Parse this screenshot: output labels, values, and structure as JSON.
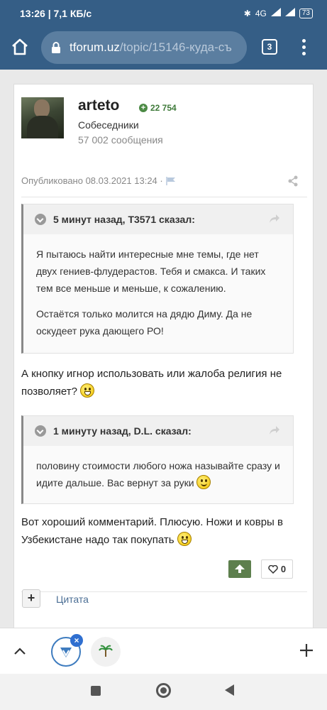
{
  "status_bar": {
    "time_speed": "13:26 | 7,1 КБ/с",
    "network": "4G",
    "battery": "73"
  },
  "browser": {
    "url_host": "tforum.uz",
    "url_path": "/topic/15146-куда-съ",
    "tab_count": "3"
  },
  "post": {
    "author": {
      "name": "arteto",
      "reputation": "22 754",
      "group": "Собеседники",
      "posts_count": "57 002 сообщения"
    },
    "published": "Опубликовано 08.03.2021 13:24 ·",
    "quotes": [
      {
        "cite": "5 минут назад, T3571 сказал:",
        "paragraphs": [
          "Я пытаюсь найти интересные мне темы, где нет двух гениев-флудерастов. Тебя и смакса. И таких тем все меньше и меньше, к сожалению.",
          "Остаётся только молится на дядю Диму. Да не оскудеет рука дающего РО!"
        ]
      },
      {
        "cite": "1 минуту назад, D.L. сказал:",
        "paragraphs": [
          "половину стоимости любого ножа называйте сразу и идите дальше. Вас вернут за руки"
        ]
      }
    ],
    "replies": [
      "А кнопку игнор использовать или жалоба религия не позволяет?",
      "Вот хороший комментарий. Плюсую. Ножи и ковры в Узбекистане надо так покупать"
    ],
    "likes": "0",
    "quote_label": "Цитата"
  },
  "colors": {
    "browser_bar": "#355e86",
    "reputation": "#3f7a3a",
    "upvote": "#5d7f4d",
    "link": "#4c6f95"
  }
}
